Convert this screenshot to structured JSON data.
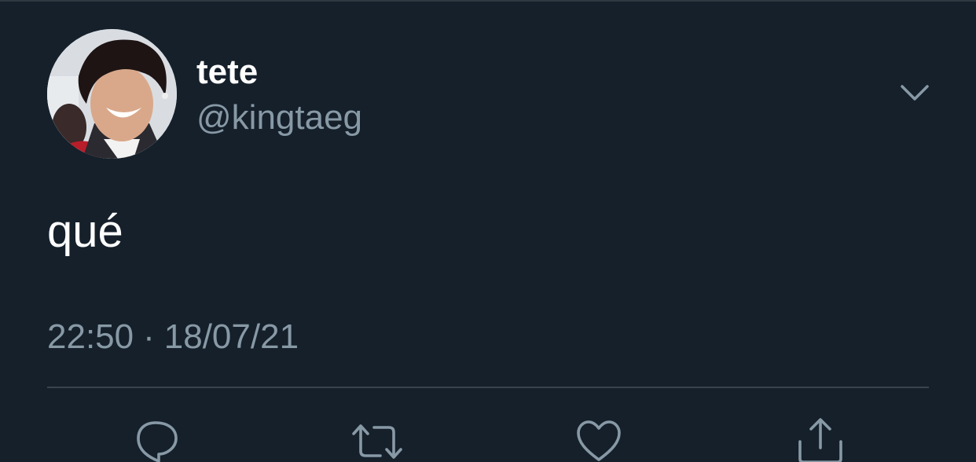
{
  "tweet": {
    "author": {
      "display_name": "tete",
      "handle": "@kingtaeg",
      "avatar_icon": "profile-photo"
    },
    "text": "qué",
    "time": "22:50",
    "separator": "·",
    "date": "18/07/21",
    "more_icon": "chevron-down-icon"
  },
  "actions": [
    {
      "name": "reply",
      "icon": "speech-bubble-icon"
    },
    {
      "name": "retweet",
      "icon": "retweet-icon"
    },
    {
      "name": "like",
      "icon": "heart-icon"
    },
    {
      "name": "share",
      "icon": "share-icon"
    }
  ],
  "colors": {
    "background": "#15202b",
    "primary_text": "#ffffff",
    "secondary_text": "#8899a6",
    "divider": "#38444d"
  }
}
